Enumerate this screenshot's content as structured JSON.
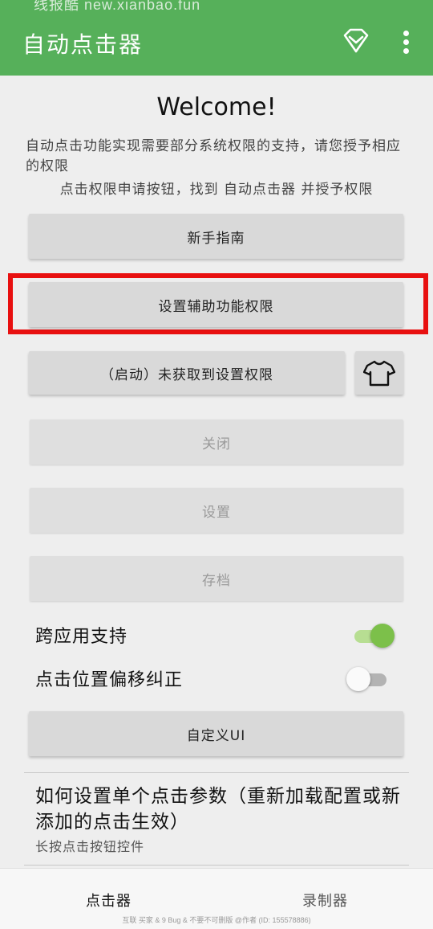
{
  "status_bar": {
    "text": "线报酷 new.xianbao.fun"
  },
  "appbar": {
    "title": "自动点击器",
    "icons": [
      "diamond-icon",
      "more-vert-icon"
    ],
    "color": "#56b05a"
  },
  "main": {
    "welcome": "Welcome!",
    "description": "自动点击功能实现需要部分系统权限的支持，请您授予相应的权限",
    "hint": "点击权限申请按钮，找到 自动点击器 并授予权限"
  },
  "buttons": {
    "guide": "新手指南",
    "accessibility": "设置辅助功能权限",
    "start": "（启动）未获取到设置权限",
    "close": "关闭",
    "settings": "设置",
    "save": "存档",
    "custom_ui": "自定义UI"
  },
  "shirt_button": {
    "icon": "shirt-icon"
  },
  "toggles": [
    {
      "label": "跨应用支持",
      "on": true,
      "accent": "#7cc04a"
    },
    {
      "label": "点击位置偏移纠正",
      "on": false
    }
  ],
  "howto": {
    "title": "如何设置单个点击参数（重新加载配置或新添加的点击生效）",
    "subtitle": "长按点击按钮控件"
  },
  "bottom_nav": {
    "items": [
      {
        "label": "点击器",
        "active": true
      },
      {
        "label": "录制器",
        "active": false
      }
    ]
  },
  "watermark": "互联 买家 & 9 Bug & 不要不可删版 @作者 (ID: 155578886)",
  "colors": {
    "highlight": "#e81010"
  }
}
